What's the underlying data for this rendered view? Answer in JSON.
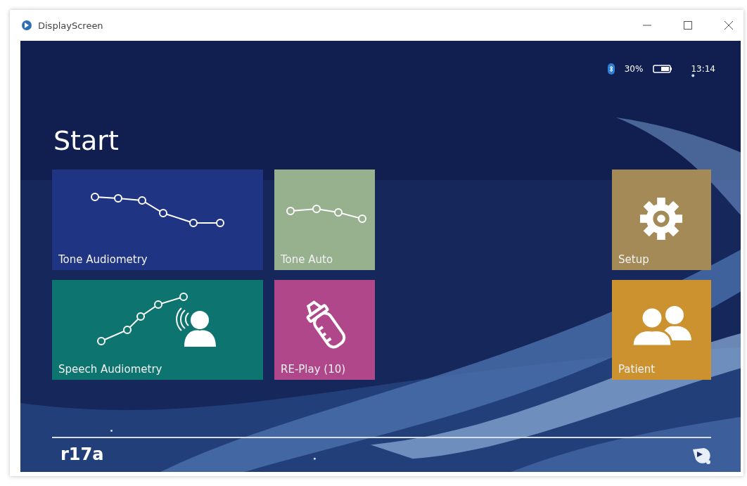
{
  "window": {
    "title": "DisplayScreen"
  },
  "status_bar": {
    "battery": "30%",
    "time": "13:14"
  },
  "heading": "Start",
  "tiles": [
    {
      "label": "Tone Audiometry",
      "color": "#1f3483",
      "kind": "tone-chart"
    },
    {
      "label": "Tone Auto",
      "color": "#97b08e",
      "kind": "auto-chart"
    },
    {
      "label": "Setup",
      "color": "#a38a56",
      "kind": "gear"
    },
    {
      "label": "Speech Audiometry",
      "color": "#0d7470",
      "kind": "speech"
    },
    {
      "label": "RE-Play (10)",
      "color": "#b0478a",
      "kind": "bottle"
    },
    {
      "label": "Patient",
      "color": "#cc922f",
      "kind": "people"
    }
  ],
  "footer": {
    "version": "r17a"
  }
}
